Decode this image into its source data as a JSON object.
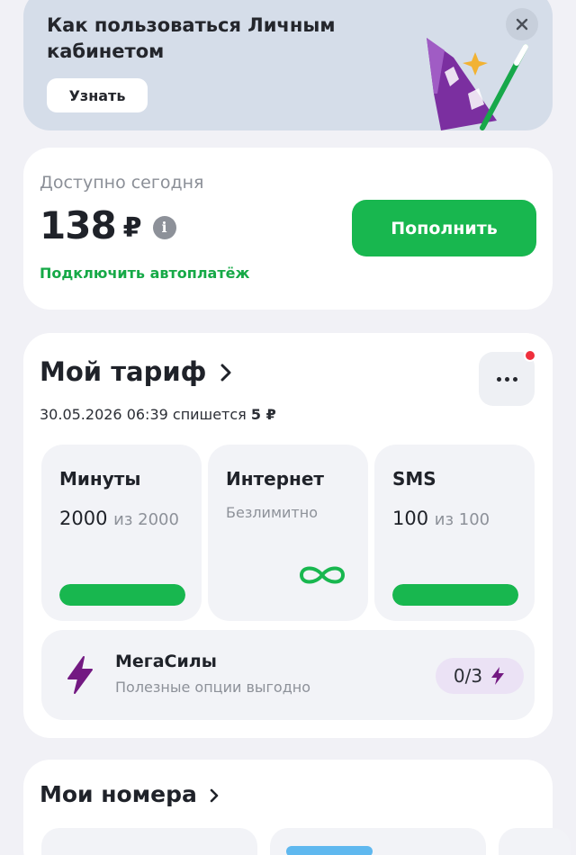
{
  "banner": {
    "title": "Как пользоваться Личным\nкабинетом",
    "button_label": "Узнать",
    "close_label": "×"
  },
  "balance": {
    "label": "Доступно сегодня",
    "amount": "138",
    "currency": "₽",
    "info_glyph": "i",
    "topup_label": "Пополнить",
    "autopay_label": "Подключить автоплатёж"
  },
  "tariff": {
    "title": "Мой тариф",
    "charge_prefix": "30.05.2026 06:39 спишется",
    "charge_amount": "5 ₽",
    "has_notification": true,
    "tiles": [
      {
        "title": "Минуты",
        "value": "2000",
        "of_text": "из 2000",
        "remaining_fraction": 1.0
      },
      {
        "title": "Интернет",
        "note": "Безлимитно",
        "icon": "infinity-icon"
      },
      {
        "title": "SMS",
        "value": "100",
        "of_text": "из 100",
        "remaining_fraction": 1.0
      }
    ],
    "megasily": {
      "title": "МегаСилы",
      "subtitle": "Полезные опции выгодно",
      "count": "0/3",
      "icon": "lightning-icon"
    }
  },
  "numbers": {
    "title": "Мои номера"
  },
  "colors": {
    "accent_green": "#18b74f",
    "accent_purple": "#731982",
    "notification_red": "#ef2f3c",
    "background": "#f1f1f6"
  }
}
